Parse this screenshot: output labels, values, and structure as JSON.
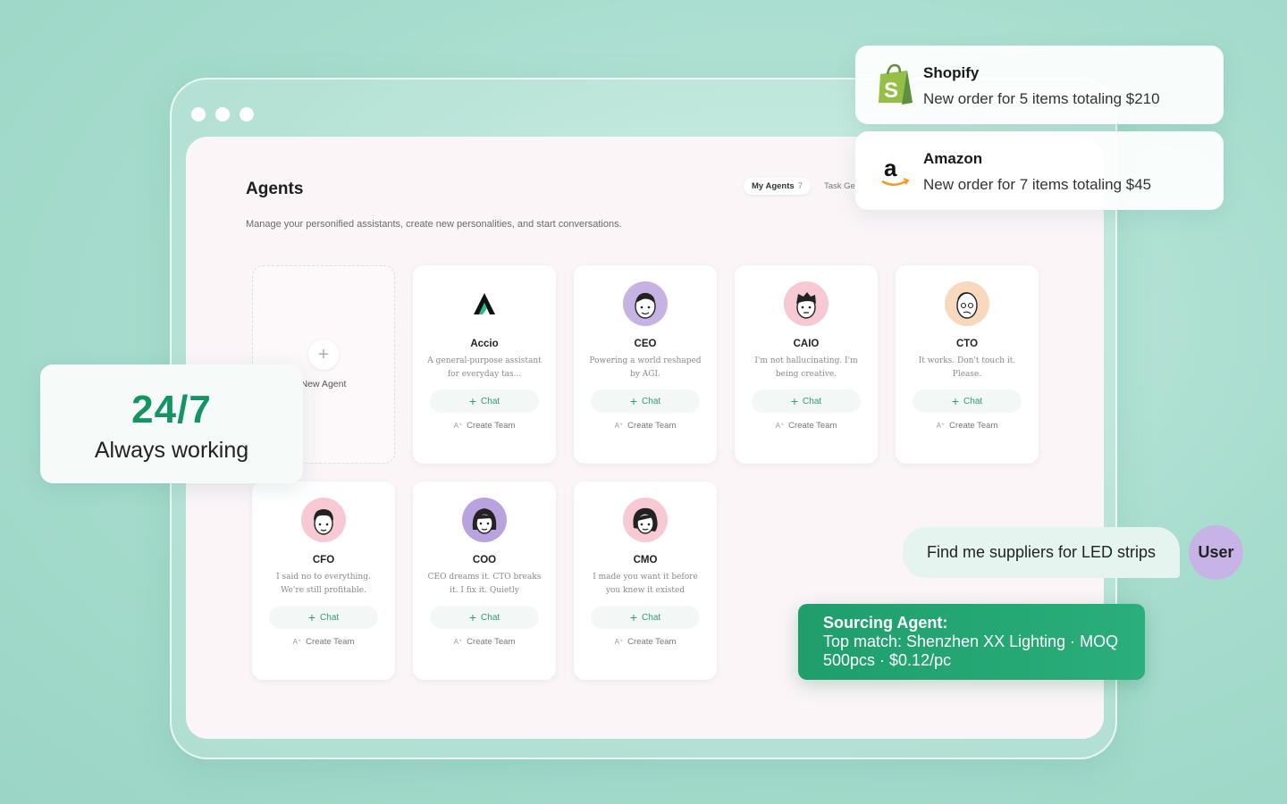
{
  "app": {
    "title": "Agents",
    "subtitle": "Manage your personified assistants, create new personalities, and start conversations.",
    "tabs": [
      {
        "label": "My Agents",
        "count": "7"
      },
      {
        "label": "Task Ge"
      }
    ]
  },
  "new_agent": {
    "label": "New Agent"
  },
  "agents": [
    {
      "name": "Accio",
      "desc": "A general-purpose assistant for everyday tas...",
      "chat": "Chat",
      "team": "Create Team"
    },
    {
      "name": "CEO",
      "desc": "Powering a world reshaped by AGI.",
      "chat": "Chat",
      "team": "Create Team"
    },
    {
      "name": "CAIO",
      "desc": "I'm not hallucinating. I'm being creative.",
      "chat": "Chat",
      "team": "Create Team"
    },
    {
      "name": "CTO",
      "desc": "It works. Don't touch it. Please.",
      "chat": "Chat",
      "team": "Create Team"
    },
    {
      "name": "CFO",
      "desc": "I said no to everything. We're still profitable.",
      "chat": "Chat",
      "team": "Create Team"
    },
    {
      "name": "COO",
      "desc": "CEO dreams it. CTO breaks it. I fix it. Quietly",
      "chat": "Chat",
      "team": "Create Team"
    },
    {
      "name": "CMO",
      "desc": "I made you want it before you knew it existed",
      "chat": "Chat",
      "team": "Create Team"
    }
  ],
  "notifications": [
    {
      "title": "Shopify",
      "body": "New order for 5 items totaling $210",
      "icon": "shopify-icon"
    },
    {
      "title": "Amazon",
      "body": "New order for 7 items totaling $45",
      "icon": "amazon-icon"
    }
  ],
  "badge": {
    "big": "24/7",
    "small": "Always working"
  },
  "conversation": {
    "user_message": "Find me suppliers for LED strips",
    "user_label": "User",
    "agent_title": "Sourcing Agent:",
    "agent_body": "Top match: Shenzhen XX Lighting · MOQ 500pcs · $0.12/pc"
  },
  "colors": {
    "accent_green": "#159463",
    "chat_green": "#2f9e6e",
    "user_avatar": "#c7b3e6",
    "background": "#a6dccd"
  }
}
